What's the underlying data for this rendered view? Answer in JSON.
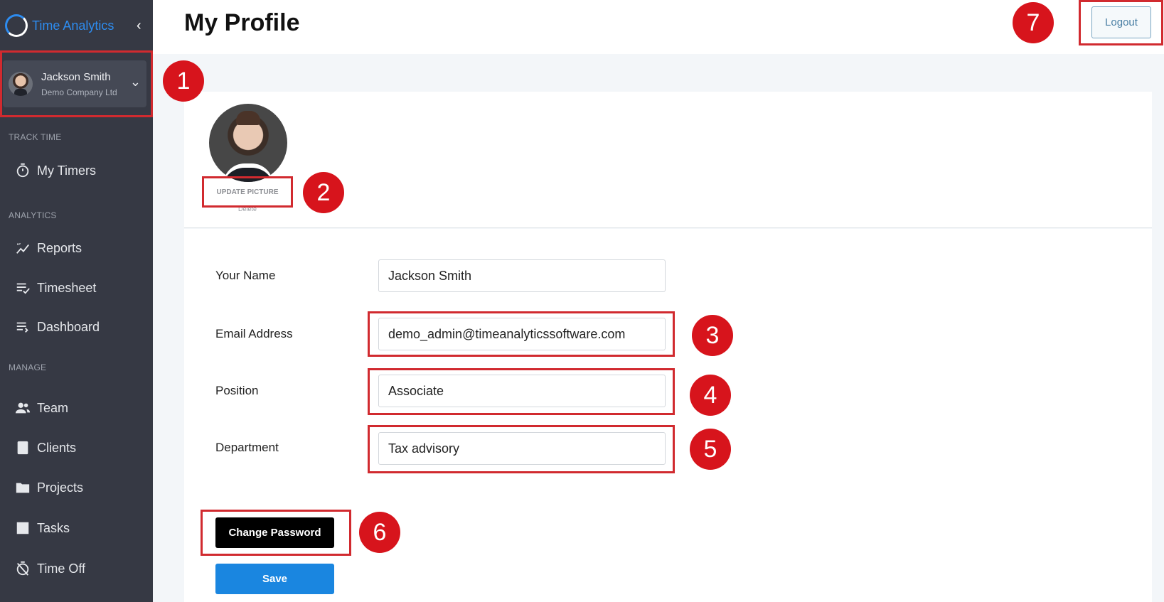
{
  "app": {
    "brand_name": "Time Analytics",
    "collapse_icon": "chevron-left-icon"
  },
  "user": {
    "name": "Jackson Smith",
    "company": "Demo Company Ltd"
  },
  "sidebar": {
    "sections": [
      {
        "label": "TRACK TIME"
      },
      {
        "label": "ANALYTICS"
      },
      {
        "label": "MANAGE"
      }
    ],
    "items": [
      {
        "label": "My Timers",
        "icon": "stopwatch-icon"
      },
      {
        "label": "Reports",
        "icon": "chart-icon"
      },
      {
        "label": "Timesheet",
        "icon": "timesheet-icon"
      },
      {
        "label": "Dashboard",
        "icon": "dashboard-icon"
      },
      {
        "label": "Team",
        "icon": "team-icon"
      },
      {
        "label": "Clients",
        "icon": "client-icon"
      },
      {
        "label": "Projects",
        "icon": "folder-icon"
      },
      {
        "label": "Tasks",
        "icon": "tasks-icon"
      },
      {
        "label": "Time Off",
        "icon": "time-off-icon"
      }
    ]
  },
  "header": {
    "title": "My Profile",
    "logout_label": "Logout"
  },
  "profile": {
    "update_picture_label": "UPDATE PICTURE",
    "delete_label": "Delete"
  },
  "form": {
    "name": {
      "label": "Your Name",
      "value": "Jackson Smith"
    },
    "email": {
      "label": "Email Address",
      "value": "demo_admin@timeanalyticssoftware.com"
    },
    "position": {
      "label": "Position",
      "value": "Associate"
    },
    "department": {
      "label": "Department",
      "value": "Tax advisory"
    },
    "change_password_label": "Change Password",
    "save_label": "Save"
  },
  "annotations": [
    "1",
    "2",
    "3",
    "4",
    "5",
    "6",
    "7"
  ],
  "colors": {
    "sidebar_bg": "#363944",
    "brand": "#2d8cf0",
    "annotation_red": "#d7141c",
    "save_button": "#1a86e0"
  }
}
